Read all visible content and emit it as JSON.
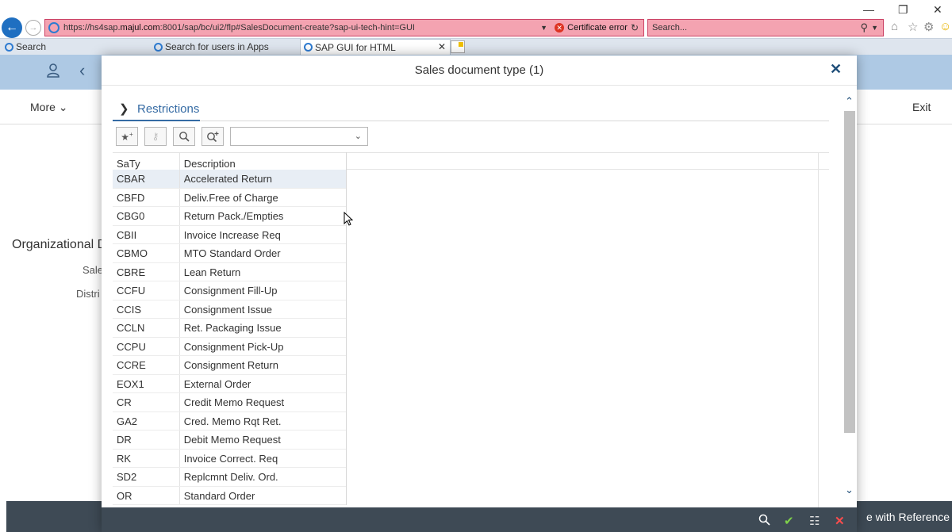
{
  "browser": {
    "url_scheme": "https://hs4sap.",
    "url_host": "majul.com",
    "url_rest": ":8001/sap/bc/ui2/flp#SalesDocument-create?sap-ui-tech-hint=GUI",
    "cert_error": "Certificate error",
    "search_placeholder": "Search...",
    "tabs": [
      {
        "label": "Search"
      },
      {
        "label": "Search for users in Apps"
      },
      {
        "label": "SAP GUI for HTML"
      }
    ]
  },
  "background": {
    "more": "More",
    "exit": "Exit",
    "org_title": "Organizational D",
    "label_sales": "Sale",
    "label_distr": "Distri",
    "footer_action": "e with Reference"
  },
  "dialog": {
    "title": "Sales document type (1)",
    "restrictions": "Restrictions",
    "columns": {
      "code": "SaTy",
      "desc": "Description"
    },
    "rows": [
      {
        "code": "CBAR",
        "desc": "Accelerated Return"
      },
      {
        "code": "CBFD",
        "desc": "Deliv.Free of Charge"
      },
      {
        "code": "CBG0",
        "desc": "Return Pack./Empties"
      },
      {
        "code": "CBII",
        "desc": "Invoice Increase Req"
      },
      {
        "code": "CBMO",
        "desc": "MTO Standard Order"
      },
      {
        "code": "CBRE",
        "desc": "Lean Return"
      },
      {
        "code": "CCFU",
        "desc": "Consignment Fill-Up"
      },
      {
        "code": "CCIS",
        "desc": "Consignment Issue"
      },
      {
        "code": "CCLN",
        "desc": "Ret. Packaging Issue"
      },
      {
        "code": "CCPU",
        "desc": "Consignment Pick-Up"
      },
      {
        "code": "CCRE",
        "desc": "Consignment Return"
      },
      {
        "code": "EOX1",
        "desc": "External Order"
      },
      {
        "code": "CR",
        "desc": "Credit Memo Request"
      },
      {
        "code": "GA2",
        "desc": "Cred. Memo Rqt Ret."
      },
      {
        "code": "DR",
        "desc": "Debit Memo Request"
      },
      {
        "code": "RK",
        "desc": "Invoice Correct. Req"
      },
      {
        "code": "SD2",
        "desc": "Replcmnt Deliv. Ord."
      },
      {
        "code": "OR",
        "desc": "Standard Order"
      }
    ]
  },
  "colors": {
    "accent": "#356ba4",
    "shell": "#aec9e4",
    "footer": "#3e4a55",
    "address_error": "#f4a3b1"
  }
}
